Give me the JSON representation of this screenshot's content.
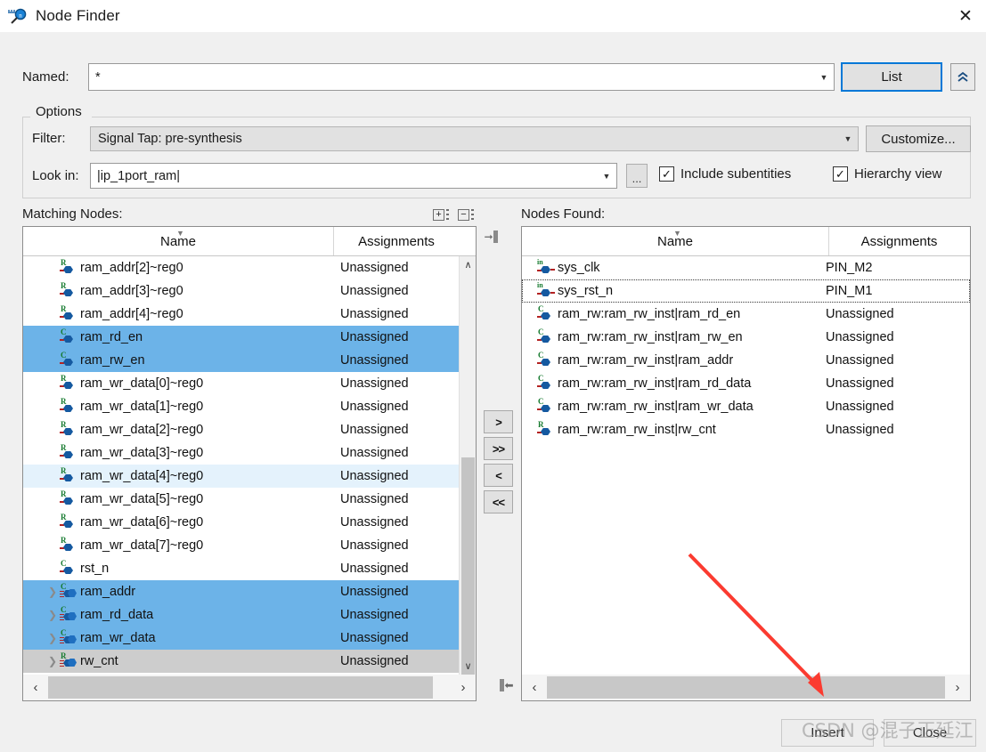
{
  "window": {
    "title": "Node Finder",
    "icon": "node-finder-magnifier-icon",
    "close_label": "✕"
  },
  "search": {
    "named_label": "Named:",
    "named_value": "*",
    "list_button": "List",
    "collapse_button": "«"
  },
  "options": {
    "group_title": "Options",
    "filter_label": "Filter:",
    "filter_value": "Signal Tap: pre-synthesis",
    "customize_button": "Customize...",
    "lookin_label": "Look in:",
    "lookin_value": "|ip_1port_ram|",
    "browse_button": "...",
    "include_subentities": {
      "label": "Include subentities",
      "checked": true
    },
    "hierarchy_view": {
      "label": "Hierarchy view",
      "checked": true
    },
    "check_glyph": "✓"
  },
  "matching": {
    "label": "Matching Nodes:",
    "expand_all_glyph": "+",
    "collapse_all_glyph": "−",
    "columns": [
      "Name",
      "Assignments"
    ],
    "rows": [
      {
        "name": "ram_addr[2]~reg0",
        "assignment": "Unassigned",
        "kind": "R",
        "expandable": false,
        "state": "normal"
      },
      {
        "name": "ram_addr[3]~reg0",
        "assignment": "Unassigned",
        "kind": "R",
        "expandable": false,
        "state": "normal"
      },
      {
        "name": "ram_addr[4]~reg0",
        "assignment": "Unassigned",
        "kind": "R",
        "expandable": false,
        "state": "normal"
      },
      {
        "name": "ram_rd_en",
        "assignment": "Unassigned",
        "kind": "C",
        "expandable": false,
        "state": "selected"
      },
      {
        "name": "ram_rw_en",
        "assignment": "Unassigned",
        "kind": "C",
        "expandable": false,
        "state": "selected"
      },
      {
        "name": "ram_wr_data[0]~reg0",
        "assignment": "Unassigned",
        "kind": "R",
        "expandable": false,
        "state": "normal"
      },
      {
        "name": "ram_wr_data[1]~reg0",
        "assignment": "Unassigned",
        "kind": "R",
        "expandable": false,
        "state": "normal"
      },
      {
        "name": "ram_wr_data[2]~reg0",
        "assignment": "Unassigned",
        "kind": "R",
        "expandable": false,
        "state": "normal"
      },
      {
        "name": "ram_wr_data[3]~reg0",
        "assignment": "Unassigned",
        "kind": "R",
        "expandable": false,
        "state": "normal"
      },
      {
        "name": "ram_wr_data[4]~reg0",
        "assignment": "Unassigned",
        "kind": "R",
        "expandable": false,
        "state": "hover"
      },
      {
        "name": "ram_wr_data[5]~reg0",
        "assignment": "Unassigned",
        "kind": "R",
        "expandable": false,
        "state": "normal"
      },
      {
        "name": "ram_wr_data[6]~reg0",
        "assignment": "Unassigned",
        "kind": "R",
        "expandable": false,
        "state": "normal"
      },
      {
        "name": "ram_wr_data[7]~reg0",
        "assignment": "Unassigned",
        "kind": "R",
        "expandable": false,
        "state": "normal"
      },
      {
        "name": "rst_n",
        "assignment": "Unassigned",
        "kind": "C",
        "expandable": false,
        "state": "normal"
      },
      {
        "name": "ram_addr",
        "assignment": "Unassigned",
        "kind": "C",
        "expandable": true,
        "state": "selected"
      },
      {
        "name": "ram_rd_data",
        "assignment": "Unassigned",
        "kind": "C",
        "expandable": true,
        "state": "selected"
      },
      {
        "name": "ram_wr_data",
        "assignment": "Unassigned",
        "kind": "C",
        "expandable": true,
        "state": "selected"
      },
      {
        "name": "rw_cnt",
        "assignment": "Unassigned",
        "kind": "R",
        "expandable": true,
        "state": "greyselected"
      }
    ]
  },
  "found": {
    "label": "Nodes Found:",
    "columns": [
      "Name",
      "Assignments"
    ],
    "rows": [
      {
        "name": "sys_clk",
        "assignment": "PIN_M2",
        "kind": "in",
        "expandable": false,
        "state": "normal"
      },
      {
        "name": "sys_rst_n",
        "assignment": "PIN_M1",
        "kind": "in",
        "expandable": false,
        "state": "focused"
      },
      {
        "name": "ram_rw:ram_rw_inst|ram_rd_en",
        "assignment": "Unassigned",
        "kind": "C",
        "expandable": false,
        "state": "normal"
      },
      {
        "name": "ram_rw:ram_rw_inst|ram_rw_en",
        "assignment": "Unassigned",
        "kind": "C",
        "expandable": false,
        "state": "normal"
      },
      {
        "name": "ram_rw:ram_rw_inst|ram_addr",
        "assignment": "Unassigned",
        "kind": "C",
        "expandable": false,
        "state": "normal"
      },
      {
        "name": "ram_rw:ram_rw_inst|ram_rd_data",
        "assignment": "Unassigned",
        "kind": "C",
        "expandable": false,
        "state": "normal"
      },
      {
        "name": "ram_rw:ram_rw_inst|ram_wr_data",
        "assignment": "Unassigned",
        "kind": "C",
        "expandable": false,
        "state": "normal"
      },
      {
        "name": "ram_rw:ram_rw_inst|rw_cnt",
        "assignment": "Unassigned",
        "kind": "R",
        "expandable": false,
        "state": "normal"
      }
    ]
  },
  "transfer": {
    "add_one": ">",
    "add_all": ">>",
    "remove_one": "<",
    "remove_all": "<<"
  },
  "footer": {
    "insert_button": "Insert",
    "close_button": "Close"
  },
  "watermark": {
    "text": "CSDN @混子正延江"
  },
  "colors": {
    "accent": "#0078d7",
    "selection": "#6cb3e8",
    "hover": "#e4f2fc",
    "grey_selection": "#cdcdcd",
    "window_bg": "#f0f0f0",
    "arrow_annotation": "#fb3b30"
  },
  "scroll": {
    "left_v_up": "∧",
    "left_v_down": "∨",
    "h_left": "‹",
    "h_right": "›"
  }
}
